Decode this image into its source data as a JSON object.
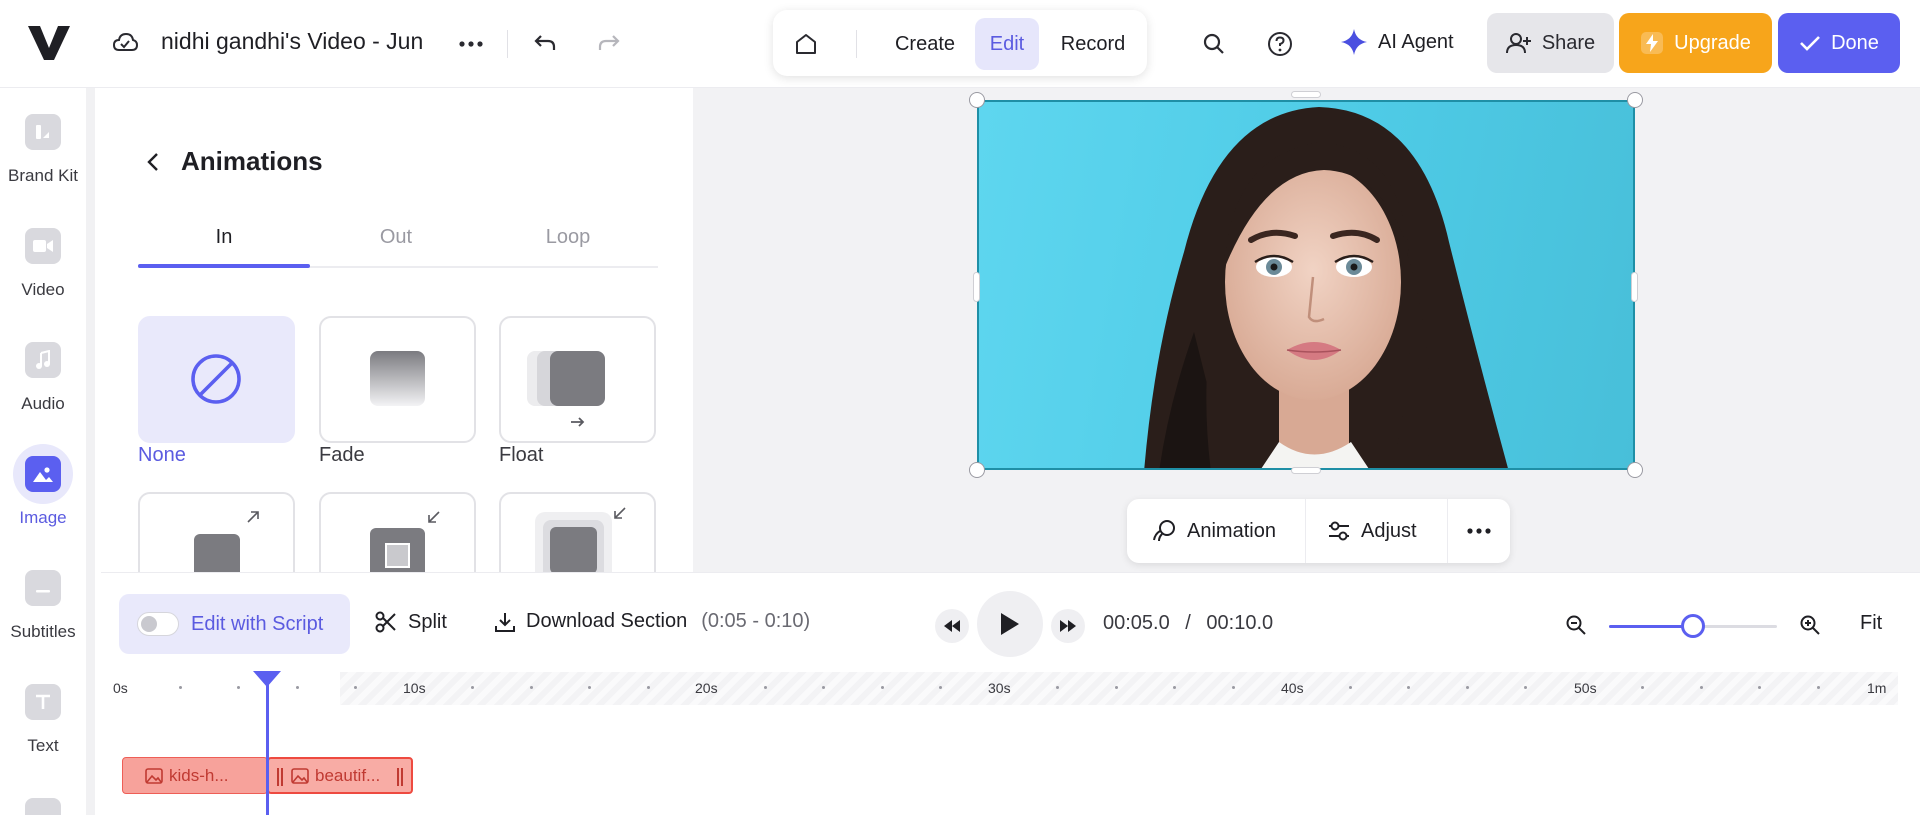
{
  "header": {
    "document_title": "nidhi gandhi's Video - Jun",
    "modes": [
      {
        "label": "Create",
        "active": false
      },
      {
        "label": "Edit",
        "active": true
      },
      {
        "label": "Record",
        "active": false
      }
    ],
    "ai_agent_label": "AI Agent",
    "share_label": "Share",
    "upgrade_label": "Upgrade",
    "done_label": "Done"
  },
  "rail": {
    "items": [
      {
        "label": "Brand Kit",
        "icon": "brand-kit-icon",
        "active": false
      },
      {
        "label": "Video",
        "icon": "video-icon",
        "active": false
      },
      {
        "label": "Audio",
        "icon": "music-note-icon",
        "active": false
      },
      {
        "label": "Image",
        "icon": "image-icon",
        "active": true
      },
      {
        "label": "Subtitles",
        "icon": "subtitles-icon",
        "active": false
      },
      {
        "label": "Text",
        "icon": "text-icon",
        "active": false
      }
    ]
  },
  "panel": {
    "title": "Animations",
    "tabs": [
      {
        "label": "In",
        "active": true
      },
      {
        "label": "Out",
        "active": false
      },
      {
        "label": "Loop",
        "active": false
      }
    ],
    "animations": [
      {
        "label": "None",
        "selected": true
      },
      {
        "label": "Fade",
        "selected": false
      },
      {
        "label": "Float",
        "selected": false
      }
    ]
  },
  "canvas": {
    "context_actions": [
      {
        "label": "Animation",
        "icon": "animation-icon"
      },
      {
        "label": "Adjust",
        "icon": "sliders-icon"
      }
    ]
  },
  "timeline": {
    "edit_with_script_label": "Edit with Script",
    "split_label": "Split",
    "download_label": "Download Section",
    "download_range": "(0:05 - 0:10)",
    "current_time": "00:05.0",
    "time_separator": "/",
    "total_time": "00:10.0",
    "fit_label": "Fit",
    "zoom_level": 0.5,
    "ruler_labels": [
      "0s",
      "10s",
      "20s",
      "30s",
      "40s",
      "50s",
      "1m"
    ],
    "clips": [
      {
        "label": "kids-h...",
        "selected": false
      },
      {
        "label": "beautif...",
        "selected": true
      }
    ]
  },
  "colors": {
    "accent": "#5b5ff0",
    "upgrade": "#f7a51b",
    "clip": "#f7a29b",
    "stage_bg": "#f2f2f4"
  }
}
